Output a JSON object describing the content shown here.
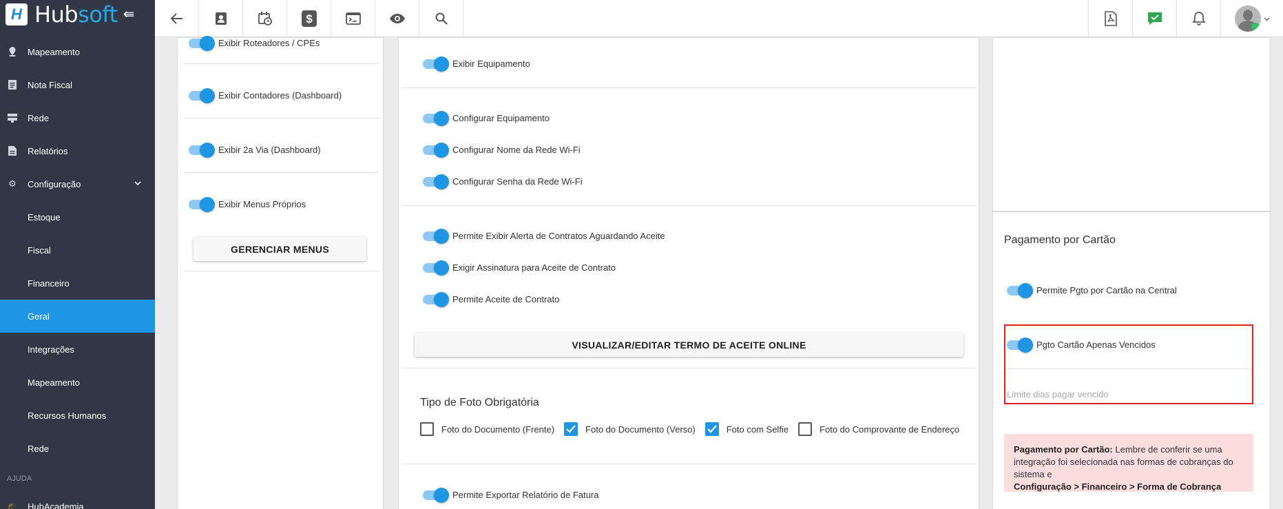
{
  "brand": {
    "logo_a": "Hub",
    "logo_b": "soft"
  },
  "sidebar": {
    "items": [
      {
        "label": "Mapeamento",
        "icon": "map-pin-icon"
      },
      {
        "label": "Nota Fiscal",
        "icon": "document-icon"
      },
      {
        "label": "Rede",
        "icon": "server-icon"
      },
      {
        "label": "Relatórios",
        "icon": "report-icon"
      },
      {
        "label": "Configuração",
        "icon": "gear-icon"
      }
    ],
    "sub_items": [
      "Estoque",
      "Fiscal",
      "Financeiro",
      "Geral",
      "Integrações",
      "Mapeamento",
      "Recursos Humanos",
      "Rede"
    ],
    "active": "Geral",
    "section_help": "AJUDA",
    "cut_item": "HubAcademia"
  },
  "topbar": {
    "icons": [
      "back-arrow-icon",
      "contact-card-icon",
      "calendar-clock-icon",
      "dollar-icon",
      "terminal-icon",
      "eye-icon",
      "search-icon"
    ],
    "right_icons": [
      "pdf-icon",
      "chat-check-icon",
      "bell-icon",
      "avatar"
    ]
  },
  "col1": {
    "toggles": [
      "Exibir Roteadores / CPEs",
      "Exibir Contadores (Dashboard)",
      "Exibir 2a Via (Dashboard)",
      "Exibir Menus Próprios"
    ],
    "button": "GERENCIAR MENUS"
  },
  "col2": {
    "toggles": [
      "Exibir Equipamento",
      "Configurar Equipamento",
      "Configurar Nome da Rede Wi-Fi",
      "Configurar Senha da Rede Wi-Fi",
      "Permite Exibir Alerta de Contratos Aguardando Aceite",
      "Exigir Assinatura para Aceite de Contrato",
      "Permite Aceite de Contrato"
    ],
    "button": "VISUALIZAR/EDITAR TERMO DE ACEITE ONLINE",
    "photo_title": "Tipo de Foto Obrigatória",
    "checkboxes": [
      {
        "label": "Foto do Documento (Frente)",
        "checked": false
      },
      {
        "label": "Foto do Documento (Verso)",
        "checked": true
      },
      {
        "label": "Foto com Selfie",
        "checked": true
      },
      {
        "label": "Foto do Comprovante de Endereço",
        "checked": false
      }
    ],
    "last_toggle": "Permite Exportar Relatório de Fatura"
  },
  "col3": {
    "title": "Pagamento por Cartão",
    "toggle1": "Permite Pgto por Cartão na Central",
    "toggle2": "Pgto Cartão Apenas Vencidos",
    "field_placeholder": "Limite dias pagar vencido",
    "alert_bold": "Pagamento por Cartão:",
    "alert_text": " Lembre de conferir se uma integração foi selecionada nas formas de cobranças do sistema e",
    "alert_path": "Configuração > Financeiro > Forma de Cobrança"
  },
  "colors": {
    "accent": "#1e96e4",
    "sidebar": "#313744",
    "highlight": "#e0201f",
    "alert_bg": "#fcdedf"
  }
}
